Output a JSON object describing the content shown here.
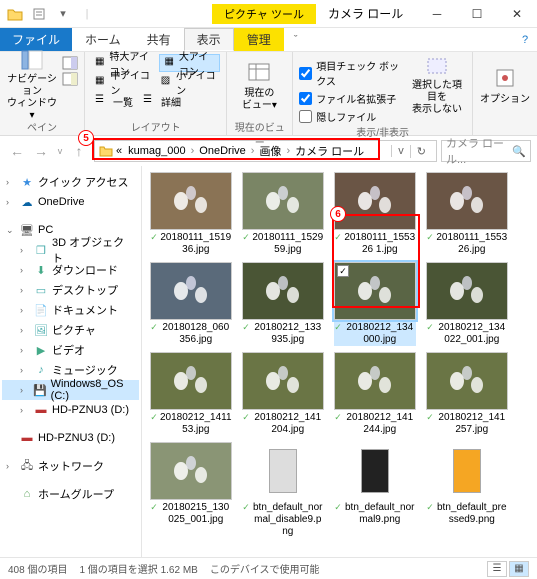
{
  "window": {
    "context_tool": "ピクチャ ツール",
    "title": "カメラ ロール"
  },
  "ribbon": {
    "file": "ファイル",
    "tabs": [
      "ホーム",
      "共有",
      "表示",
      "管理"
    ],
    "active_tab": "表示",
    "groups": {
      "pane": {
        "label": "ペイン",
        "nav_btn": "ナビゲーション\nウィンドウ▾"
      },
      "layout": {
        "label": "レイアウト",
        "items": [
          "特大アイコン",
          "大アイコン",
          "中アイコン",
          "小アイコン",
          "一覧",
          "詳細"
        ],
        "active": "大アイコン"
      },
      "current": {
        "label": "現在のビュー",
        "btn": "現在の\nビュー▾"
      },
      "showhide": {
        "label": "表示/非表示",
        "checks": [
          "項目チェック ボックス",
          "ファイル名拡張子",
          "隠しファイル"
        ],
        "hide_btn": "選択した項目を\n表示しない"
      },
      "options": "オプション"
    }
  },
  "breadcrumb": {
    "prefix": "«",
    "parts": [
      "kumag_000",
      "OneDrive",
      "画像",
      "カメラ ロール"
    ]
  },
  "search": {
    "placeholder": "カメラ ロール..."
  },
  "tree": {
    "items": [
      {
        "icon": "star",
        "label": "クイック アクセス",
        "chev": ">",
        "color": "#3b8ee0"
      },
      {
        "icon": "cloud",
        "label": "OneDrive",
        "chev": ">",
        "color": "#0a64a4"
      },
      {
        "icon": "pc",
        "label": "PC",
        "chev": "v",
        "color": "#555"
      },
      {
        "icon": "3d",
        "label": "3D オブジェクト",
        "chev": ">",
        "indent": 1,
        "color": "#4aa"
      },
      {
        "icon": "dl",
        "label": "ダウンロード",
        "chev": ">",
        "indent": 1,
        "color": "#4a8"
      },
      {
        "icon": "desk",
        "label": "デスクトップ",
        "chev": ">",
        "indent": 1,
        "color": "#4aa"
      },
      {
        "icon": "doc",
        "label": "ドキュメント",
        "chev": ">",
        "indent": 1,
        "color": "#4a8"
      },
      {
        "icon": "pic",
        "label": "ピクチャ",
        "chev": ">",
        "indent": 1,
        "color": "#4aa"
      },
      {
        "icon": "vid",
        "label": "ビデオ",
        "chev": ">",
        "indent": 1,
        "color": "#4a8"
      },
      {
        "icon": "mus",
        "label": "ミュージック",
        "chev": ">",
        "indent": 1,
        "color": "#4aa"
      },
      {
        "icon": "disk",
        "label": "Windows8_OS (C:)",
        "chev": ">",
        "indent": 1,
        "selected": true,
        "color": "#888"
      },
      {
        "icon": "hdd",
        "label": "HD-PZNU3 (D:)",
        "chev": ">",
        "indent": 1,
        "color": "#b33"
      },
      {
        "icon": "hdd",
        "label": "HD-PZNU3 (D:)",
        "chev": "",
        "color": "#b33"
      },
      {
        "icon": "net",
        "label": "ネットワーク",
        "chev": ">",
        "color": "#555"
      },
      {
        "icon": "home",
        "label": "ホームグループ",
        "chev": "",
        "color": "#6a6"
      }
    ]
  },
  "files": [
    {
      "name": "20180111_151936.jpg",
      "bg": "#8a7355"
    },
    {
      "name": "20180111_152959.jpg",
      "bg": "#7a8565"
    },
    {
      "name": "20180111_155326 1.jpg",
      "bg": "#6a5545"
    },
    {
      "name": "20180111_155326.jpg",
      "bg": "#6a5545"
    },
    {
      "name": "20180128_060356.jpg",
      "bg": "#5a6a7a"
    },
    {
      "name": "20180212_133935.jpg",
      "bg": "#4a5535"
    },
    {
      "name": "20180212_134000.jpg",
      "bg": "#5a6545",
      "selected": true,
      "checked": true
    },
    {
      "name": "20180212_134022_001.jpg",
      "bg": "#4a5535"
    },
    {
      "name": "20180212_141153.jpg",
      "bg": "#6a7545"
    },
    {
      "name": "20180212_141204.jpg",
      "bg": "#6a7545"
    },
    {
      "name": "20180212_141244.jpg",
      "bg": "#6a7545"
    },
    {
      "name": "20180212_141257.jpg",
      "bg": "#6a7545"
    },
    {
      "name": "20180215_130025_001.jpg",
      "bg": "#8a9575"
    },
    {
      "name": "btn_default_normal_disable9.png",
      "icon": true,
      "iconbg": "#ddd"
    },
    {
      "name": "btn_default_normal9.png",
      "icon": true,
      "iconbg": "#222"
    },
    {
      "name": "btn_default_pressed9.png",
      "icon": true,
      "iconbg": "#f5a623"
    }
  ],
  "status": {
    "count": "408 個の項目",
    "selection": "1 個の項目を選択 1.62 MB",
    "device": "このデバイスで使用可能"
  },
  "annotations": {
    "a5": "5",
    "a6": "6"
  }
}
